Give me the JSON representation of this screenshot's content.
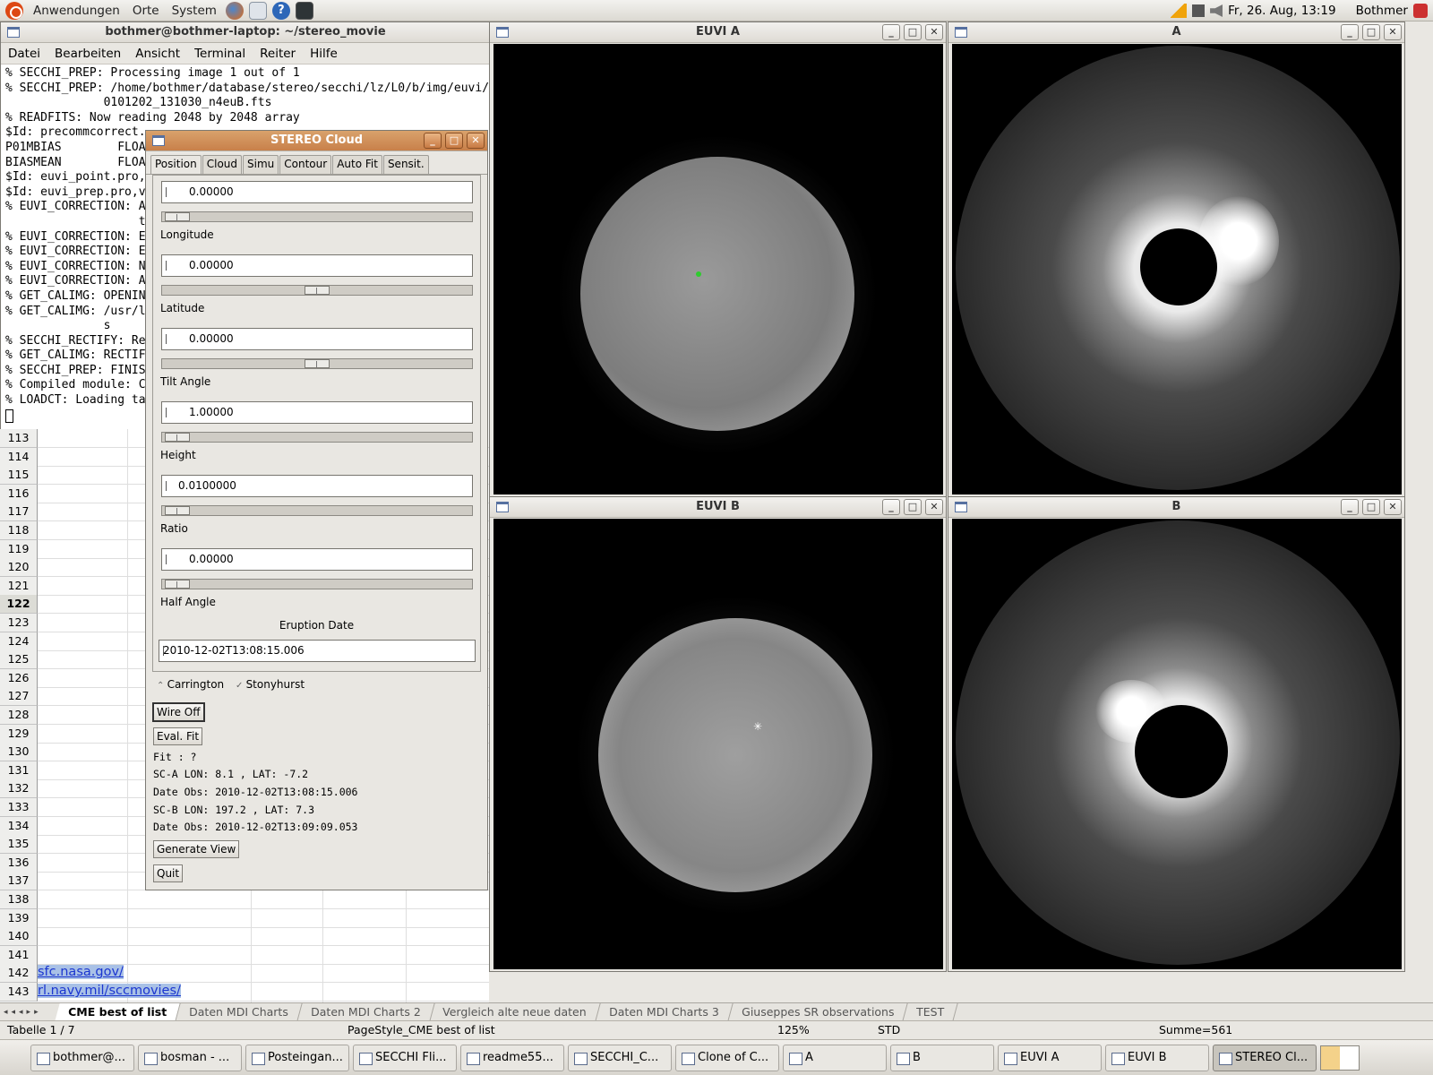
{
  "top_panel": {
    "menus": [
      "Anwendungen",
      "Orte",
      "System"
    ],
    "datetime": "Fr, 26. Aug, 13:19",
    "user": "Bothmer"
  },
  "terminal": {
    "title": "bothmer@bothmer-laptop: ~/stereo_movie",
    "menu": [
      "Datei",
      "Bearbeiten",
      "Ansicht",
      "Terminal",
      "Reiter",
      "Hilfe"
    ],
    "lines": [
      "% SECCHI_PREP: Processing image 1 out of 1",
      "% SECCHI_PREP: /home/bothmer/database/stereo/secchi/lz/L0/b/img/euvi/",
      "              0101202_131030_n4euB.fts",
      "% READFITS: Now reading 2048 by 2048 array",
      "$Id: precommcorrect.",
      "P01MBIAS        FLOA",
      "BIASMEAN        FLOA",
      "$Id: euvi_point.pro,",
      "$Id: euvi_prep.pro,v",
      "% EUVI_CORRECTION: A",
      "                   t",
      "% EUVI_CORRECTION: E",
      "% EUVI_CORRECTION: E",
      "% EUVI_CORRECTION: N",
      "% EUVI_CORRECTION: A",
      "% GET_CALIMG: OPENIN",
      "% GET_CALIMG: /usr/l",
      "              s",
      "% SECCHI_RECTIFY: Re",
      "% GET_CALIMG: RECTIF",
      "% SECCHI_PREP: FINIS",
      "% Compiled module: C",
      "% LOADCT: Loading ta"
    ]
  },
  "sheet": {
    "rows": [
      "113",
      "114",
      "115",
      "116",
      "117",
      "118",
      "119",
      "120",
      "121",
      "122",
      "123",
      "124",
      "125",
      "126",
      "127",
      "128",
      "129",
      "130",
      "131",
      "132",
      "133",
      "134",
      "135",
      "136",
      "137",
      "138",
      "139",
      "140",
      "141",
      "142",
      "143"
    ],
    "selected_row": "122",
    "links": [
      "sfc.nasa.gov/",
      "rl.navy.mil/sccmovies/"
    ]
  },
  "cloud": {
    "title": "STEREO Cloud",
    "tabs": [
      "Position",
      "Cloud",
      "Simu",
      "Contour",
      "Auto Fit",
      "Sensit."
    ],
    "fields": [
      {
        "value": "0.00000",
        "label": "Longitude",
        "slider": 0.01
      },
      {
        "value": "0.00000",
        "label": "Latitude",
        "slider": 0.5
      },
      {
        "value": "0.00000",
        "label": "Tilt Angle",
        "slider": 0.5
      },
      {
        "value": "1.00000",
        "label": "Height",
        "slider": 0.01
      },
      {
        "value": "0.0100000",
        "label": "Ratio",
        "slider": 0.01
      },
      {
        "value": "0.00000",
        "label": "Half Angle",
        "slider": 0.01
      }
    ],
    "eruption_label": "Eruption Date",
    "eruption_date": "2010-12-02T13:08:15.006",
    "radio": [
      "Carrington",
      "Stonyhurst"
    ],
    "wire_button": "Wire Off",
    "eval_button": "Eval. Fit",
    "fit": "Fit : ?",
    "sca": "SC-A LON:    8.1 , LAT:  -7.2",
    "date_a": "Date Obs: 2010-12-02T13:08:15.006",
    "scb": "SC-B LON:  197.2 , LAT:   7.3",
    "date_b": "Date Obs: 2010-12-02T13:09:09.053",
    "generate_button": "Generate View",
    "quit_button": "Quit"
  },
  "image_windows": {
    "euvi_a": "EUVI A",
    "cor_a": "A",
    "euvi_b": "EUVI B",
    "cor_b": "B"
  },
  "sheet_tabs": [
    "CME best of list",
    "Daten  MDI Charts",
    "Daten  MDI Charts 2",
    "Vergleich alte neue daten",
    "Daten  MDI Charts 3",
    "Giuseppes SR observations",
    "TEST"
  ],
  "status": {
    "table": "Tabelle 1 / 7",
    "pagestyle": "PageStyle_CME best of list",
    "zoom": "125%",
    "mode": "STD",
    "sum": "Summe=561"
  },
  "taskbar": [
    "bothmer@...",
    "bosman - ...",
    "Posteingan...",
    "SECCHI Fli...",
    "readme55...",
    "SECCHI_C...",
    "Clone of C...",
    "A",
    "B",
    "EUVI A",
    "EUVI B",
    "STEREO Cl..."
  ]
}
